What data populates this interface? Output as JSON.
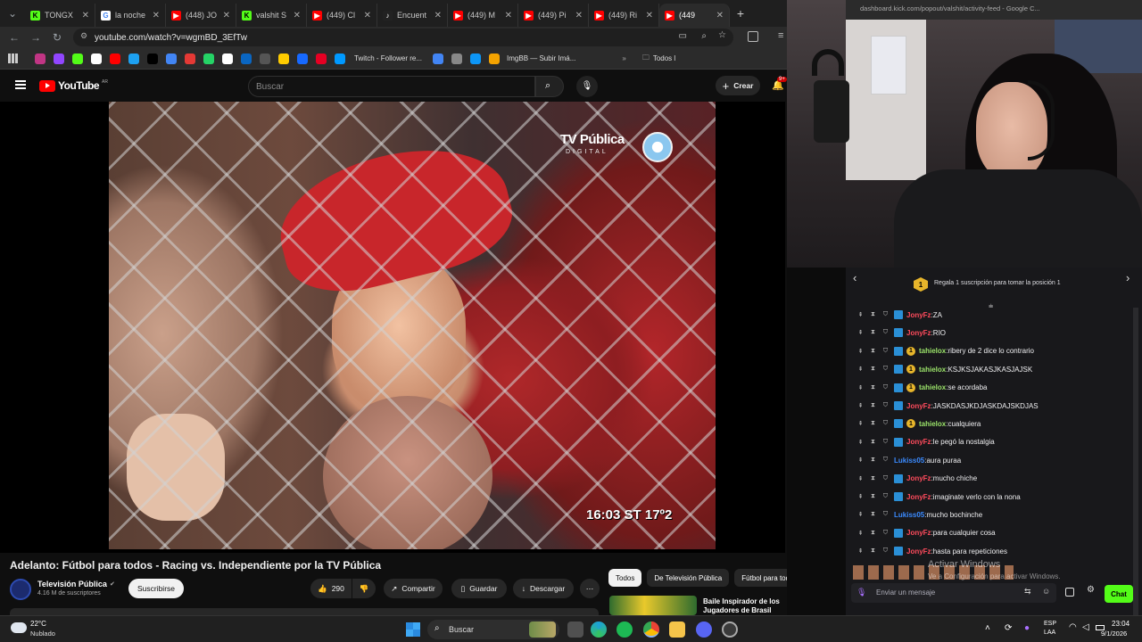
{
  "browser": {
    "tabs": [
      {
        "label": "TONGX",
        "favicon_color": "#53fc18",
        "favicon": "K"
      },
      {
        "label": "la noche",
        "favicon_color": "#ffffff",
        "favicon": "G"
      },
      {
        "label": "(448) JO",
        "favicon_color": "#ff0000",
        "favicon": "▶"
      },
      {
        "label": "valshit S",
        "favicon_color": "#53fc18",
        "favicon": "K"
      },
      {
        "label": "(449) Cl",
        "favicon_color": "#ff0000",
        "favicon": "▶"
      },
      {
        "label": "Encuent",
        "favicon_color": "#222222",
        "favicon": "♪"
      },
      {
        "label": "(449) M",
        "favicon_color": "#ff0000",
        "favicon": "▶"
      },
      {
        "label": "(449) Pi",
        "favicon_color": "#ff0000",
        "favicon": "▶"
      },
      {
        "label": "(449) Ri",
        "favicon_color": "#ff0000",
        "favicon": "▶"
      },
      {
        "label": "(449",
        "favicon_color": "#ff0000",
        "favicon": "▶"
      }
    ],
    "new_tab": "+",
    "url": "youtube.com/watch?v=wgmBD_3EfTw",
    "bookmarks": [
      "Twitch - Follower re...",
      "ImgBB — Subir Imá...",
      "Todos l"
    ],
    "bookmark_colors": [
      "#c13584",
      "#9146ff",
      "#53fc18",
      "#ffffff",
      "#ff0000",
      "#1da1f2",
      "#000000",
      "#4285f4",
      "#e53935",
      "#25d366",
      "#ffffff",
      "#0a66c2",
      "#555555",
      "#ffcc00",
      "#1769ff",
      "#e60023",
      "#0099ff"
    ]
  },
  "youtube": {
    "logo": "YouTube",
    "region": "AR",
    "search_placeholder": "Buscar",
    "create_label": "Crear",
    "notifications": "9+"
  },
  "video": {
    "broadcaster_logo": "TV Pública",
    "broadcaster_sub": "DIGITAL",
    "clock": "16:03 ST 17º2",
    "title": "Adelanto: Fútbol para todos - Racing vs. Independiente por la TV Pública",
    "channel_name": "Televisión Pública",
    "subscribers": "4.16 M de suscriptores",
    "subscribe_label": "Suscribirse",
    "likes": "290",
    "share_label": "Compartir",
    "save_label": "Guardar",
    "download_label": "Descargar"
  },
  "related": {
    "chips": [
      "Todos",
      "De Televisión Pública",
      "Fútbol para tod"
    ],
    "first_title": "Baile Inspirador de los Jugadores de Brasil sa..."
  },
  "stream_overlay": {
    "url": "dashboard.kick.com/popout/valshit/activity-feed - Google C...",
    "gift_prompt": "Regala 1 suscripción para tomar la posición 1",
    "gift_rank": "1",
    "messages": [
      {
        "user": "JonyFz",
        "text": "ZA",
        "color": "#ff4b5c",
        "sub": false,
        "avatar": true
      },
      {
        "user": "JonyFz",
        "text": "RIO",
        "color": "#ff4b5c",
        "sub": false,
        "avatar": true
      },
      {
        "user": "tahielox",
        "text": "ribery de 2 dice lo contrario",
        "color": "#9be36a",
        "sub": true,
        "avatar": true
      },
      {
        "user": "tahielox",
        "text": "KSJKSJAKASJKASJAJSK",
        "color": "#9be36a",
        "sub": true,
        "avatar": true
      },
      {
        "user": "tahielox",
        "text": "se acordaba",
        "color": "#9be36a",
        "sub": true,
        "avatar": true
      },
      {
        "user": "JonyFz",
        "text": "JASKDASJKDJASKDAJSKDJAS",
        "color": "#ff4b5c",
        "sub": false,
        "avatar": true
      },
      {
        "user": "tahielox",
        "text": "cualquiera",
        "color": "#9be36a",
        "sub": true,
        "avatar": true
      },
      {
        "user": "JonyFz",
        "text": "le pegó la nostalgia",
        "color": "#ff4b5c",
        "sub": false,
        "avatar": true
      },
      {
        "user": "Lukiss05",
        "text": "aura puraa",
        "color": "#3b8bff",
        "sub": false,
        "avatar": false
      },
      {
        "user": "JonyFz",
        "text": "mucho chiche",
        "color": "#ff4b5c",
        "sub": false,
        "avatar": true
      },
      {
        "user": "JonyFz",
        "text": "imaginate verlo con la nona",
        "color": "#ff4b5c",
        "sub": false,
        "avatar": true
      },
      {
        "user": "Lukiss05",
        "text": "mucho bochinche",
        "color": "#3b8bff",
        "sub": false,
        "avatar": false
      },
      {
        "user": "JonyFz",
        "text": "para cualquier cosa",
        "color": "#ff4b5c",
        "sub": false,
        "avatar": true
      },
      {
        "user": "JonyFz",
        "text": "hasta para repeticiones",
        "color": "#ff4b5c",
        "sub": false,
        "avatar": true
      }
    ],
    "activate_windows_title": "Activar Windows",
    "activate_windows_sub": "Ve a Configuración para activar Windows.",
    "chat_placeholder": "Enviar un mensaje",
    "chat_button": "Chat"
  },
  "taskbar": {
    "weather_temp": "22°C",
    "weather_desc": "Nublado",
    "search_label": "Buscar",
    "lang": "ESP",
    "lang_sub": "LAA",
    "time": "23:04",
    "date": "9/1/2026"
  }
}
